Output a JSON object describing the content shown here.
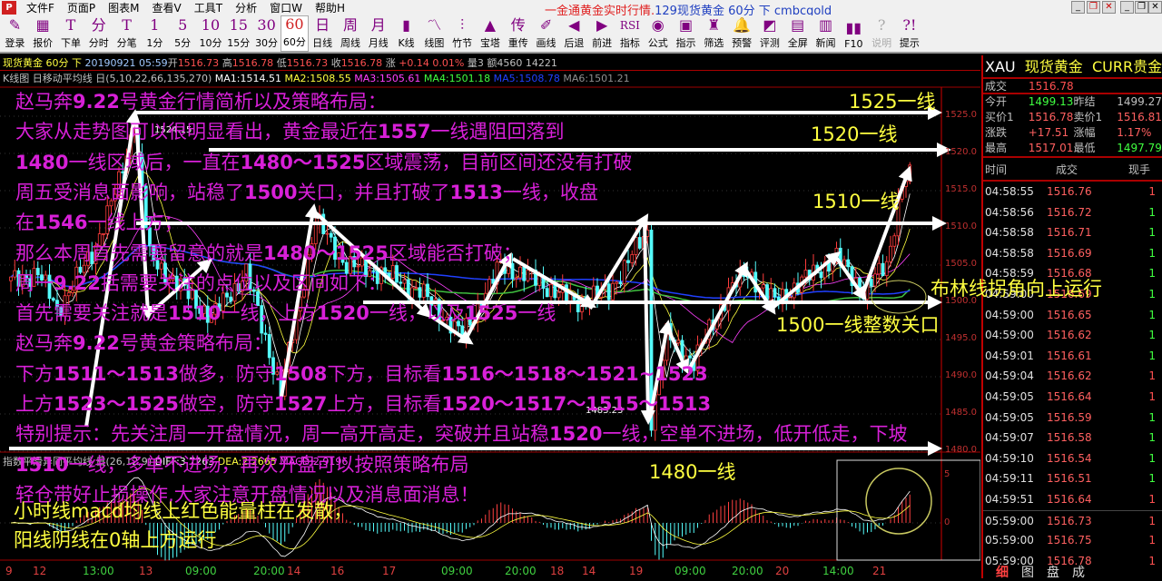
{
  "menubar": {
    "logo": "P",
    "items": [
      "文件F",
      "页面P",
      "图表M",
      "查看V",
      "工具T",
      "分析",
      "窗口W",
      "帮助H"
    ],
    "title_a": "一金通黄金实时行情.",
    "title_b": "129现货黄金 60分 下 cmbcgold"
  },
  "toolbar": [
    {
      "icon": "✎",
      "label": "登录"
    },
    {
      "icon": "▦",
      "label": "报价"
    },
    {
      "icon": "T",
      "label": "下单"
    },
    {
      "icon": "分",
      "label": "分时"
    },
    {
      "icon": "T",
      "label": "分笔"
    },
    {
      "icon": "1",
      "label": "1分"
    },
    {
      "icon": "5",
      "label": "5分"
    },
    {
      "icon": "10",
      "label": "10分"
    },
    {
      "icon": "15",
      "label": "15分"
    },
    {
      "icon": "30",
      "label": "30分"
    },
    {
      "icon": "60",
      "label": "60分",
      "selected": true
    },
    {
      "icon": "日",
      "label": "日线"
    },
    {
      "icon": "周",
      "label": "周线"
    },
    {
      "icon": "月",
      "label": "月线"
    },
    {
      "icon": "▮",
      "label": "K线"
    },
    {
      "icon": "〽",
      "label": "线图"
    },
    {
      "icon": "⫶",
      "label": "竹节"
    },
    {
      "icon": "▲",
      "label": "宝塔"
    },
    {
      "icon": "传",
      "label": "重传"
    },
    {
      "icon": "✐",
      "label": "画线"
    },
    {
      "icon": "◀",
      "label": "后退"
    },
    {
      "icon": "▶",
      "label": "前进"
    },
    {
      "icon": "RSI",
      "label": "指标"
    },
    {
      "icon": "◉",
      "label": "公式"
    },
    {
      "icon": "▣",
      "label": "指示"
    },
    {
      "icon": "♜",
      "label": "筛选"
    },
    {
      "icon": "🔔",
      "label": "预警"
    },
    {
      "icon": "◩",
      "label": "评测"
    },
    {
      "icon": "▤",
      "label": "全屏"
    },
    {
      "icon": "▥",
      "label": "新闻"
    },
    {
      "icon": "▮▮",
      "label": "F10"
    },
    {
      "icon": "?",
      "label": "说明",
      "disabled": true
    },
    {
      "icon": "?!",
      "label": "提示"
    }
  ],
  "info": {
    "name": "现货黄金 60分 下",
    "datetime": "20190921 05:59",
    "open_l": "开",
    "open": "1516.73",
    "high_l": "高",
    "high": "1516.78",
    "low_l": "低",
    "low": "1516.73",
    "close_l": "收",
    "close": "1516.78",
    "chg_l": "涨",
    "chg": "+0.14 0.01%",
    "vol": "量3",
    "amt": "额4560 14221"
  },
  "ma": {
    "title": "K线图 日移动平均线 日(5,10,22,66,135,270)",
    "ma1": "MA1:1514.51",
    "ma2": "MA2:1508.55",
    "ma3": "MA3:1505.61",
    "ma4": "MA4:1501.18",
    "ma5": "MA5:1508.78",
    "ma6": "MA6:1501.21"
  },
  "price_axis": [
    "1525.0",
    "1520.0",
    "1515.0",
    "1510.0",
    "1505.0",
    "1500.0",
    "1495.0",
    "1490.0",
    "1485.0",
    "1480.0"
  ],
  "macd": {
    "title": "指数平滑异同平均线 日(26,12,9)",
    "diff": "DIFF:3.7263",
    "dea": "DEA:2.2665",
    "macd": "MACD:2.9196",
    "axis": [
      "5",
      "0"
    ]
  },
  "time_axis": [
    {
      "t": "9",
      "d": true
    },
    {
      "t": "12",
      "d": true
    },
    {
      "t": "13:00"
    },
    {
      "t": "13",
      "d": true
    },
    {
      "t": "09:00"
    },
    {
      "t": "20:00"
    },
    {
      "t": "14",
      "d": true
    },
    {
      "t": "16",
      "d": true
    },
    {
      "t": "17",
      "d": true
    },
    {
      "t": "09:00"
    },
    {
      "t": "20:00"
    },
    {
      "t": "18",
      "d": true
    },
    {
      "t": "14",
      "d": true
    },
    {
      "t": "19",
      "d": true
    },
    {
      "t": "09:00"
    },
    {
      "t": "20:00"
    },
    {
      "t": "20",
      "d": true
    },
    {
      "t": "14:00"
    },
    {
      "t": "21",
      "d": true
    }
  ],
  "price_labels": {
    "high": "1524.15",
    "low": "1483.23"
  },
  "chart_data": {
    "type": "candlestick",
    "ylim": [
      1478,
      1528
    ],
    "waypoints_bar": [
      0,
      7,
      12,
      21,
      28,
      32,
      36,
      45,
      52,
      61,
      70,
      79,
      87,
      96,
      106,
      117,
      127,
      136,
      146,
      155,
      165,
      166,
      170,
      177,
      186,
      191,
      198,
      205,
      214,
      221,
      227,
      231,
      233
    ],
    "waypoints_price": [
      1502.8,
      1504,
      1499,
      1506.5,
      1516,
      1524.2,
      1506,
      1501.5,
      1498,
      1504,
      1488,
      1511,
      1505,
      1504,
      1501.5,
      1495.5,
      1505,
      1503,
      1500,
      1501.5,
      1509.5,
      1484.5,
      1495.5,
      1492,
      1501.5,
      1504,
      1500,
      1502.8,
      1506,
      1501.5,
      1505,
      1516,
      1516.8
    ]
  },
  "overlay_lines": [
    [
      "赵马奔",
      "9.22",
      "号黄金行情简析以及策略布局："
    ],
    [
      "大家从走势图可以很明显看出，黄金最近在",
      "1557",
      "一线遇阻回落到"
    ],
    [
      "1480",
      "一线区域后，一直在",
      "1480～1525",
      "区域震荡，目前区间还没有打破"
    ],
    [
      "周五受消息面影响，站稳了",
      "1500",
      "关口，并且打破了",
      "1513",
      "一线，收盘"
    ],
    [
      "在",
      "1546",
      "一线上方；"
    ],
    [
      "那么本周首先需要留意的就是",
      "1480～1525",
      "区域能否打破；"
    ],
    [
      "周一",
      "9.22",
      "括需要关注的点位以及区间如下："
    ],
    [
      "首先需要关注就是",
      "1510",
      "一线，上方",
      "1520",
      "一线，以及",
      "1525",
      "一线"
    ],
    [
      "赵马奔",
      "9.22",
      "号黄金策略布局："
    ],
    [
      "下方",
      "1511～1513",
      "做多，防守",
      "1508",
      "下方，目标看",
      "1516～1518～1521~1523"
    ],
    [
      "上方",
      "1523～1525",
      "做空，防守",
      "1527",
      "上方，目标看",
      "1520～1517～1515～1513"
    ],
    [
      "特别提示：先关注周一开盘情况，周一高开高走，突破并且站稳",
      "1520",
      "一线，空单不进场，低开低走，下坡"
    ],
    [
      "1510",
      "一线，多单不进场，再次开盘可以按照策略布局"
    ],
    [
      "轻仓带好止损操作,大家注意开盘情况以及消息面消息！"
    ]
  ],
  "annotations": {
    "a1525": "1525一线",
    "a1520": "1520一线",
    "a1510": "1510一线",
    "a1500": "1500一线整数关口",
    "boll": "布林线拐角向上运行",
    "a1480": "1480一线",
    "macd1": "小时线macd均线上红色能量柱在发散，",
    "macd2": "阳线阴线在0轴上方运行"
  },
  "right_panel": {
    "code": "XAU",
    "name": "现货黄金",
    "market": "CURR贵金",
    "last_l": "成交",
    "last": "1516.78",
    "quotes": [
      [
        "今开",
        "1499.13",
        "昨结",
        "1499.27"
      ],
      [
        "买价1",
        "1516.78",
        "卖价1",
        "1516.81"
      ],
      [
        "涨跌",
        "+17.51",
        "涨幅",
        "1.17%"
      ],
      [
        "最高",
        "1517.01",
        "最低",
        "1497.79"
      ]
    ],
    "tick_headers": [
      "时间",
      "成交",
      "现手"
    ],
    "ticks": [
      [
        "04:58:55",
        "1516.76",
        "1",
        "up"
      ],
      [
        "04:58:56",
        "1516.72",
        "1",
        "dn"
      ],
      [
        "04:58:58",
        "1516.71",
        "1",
        "dn"
      ],
      [
        "04:58:58",
        "1516.69",
        "1",
        "dn"
      ],
      [
        "04:58:59",
        "1516.68",
        "1",
        "dn"
      ],
      [
        "04:59:00",
        "1516.69",
        "1",
        "dn"
      ],
      [
        "04:59:00",
        "1516.65",
        "1",
        "dn"
      ],
      [
        "04:59:00",
        "1516.62",
        "1",
        "dn"
      ],
      [
        "04:59:01",
        "1516.61",
        "1",
        "dn"
      ],
      [
        "04:59:04",
        "1516.62",
        "1",
        "up"
      ],
      [
        "04:59:05",
        "1516.64",
        "1",
        "up"
      ],
      [
        "04:59:05",
        "1516.59",
        "1",
        "dn"
      ],
      [
        "04:59:07",
        "1516.58",
        "1",
        "dn"
      ],
      [
        "04:59:10",
        "1516.54",
        "1",
        "dn"
      ],
      [
        "04:59:11",
        "1516.51",
        "1",
        "dn"
      ],
      [
        "04:59:51",
        "1516.64",
        "1",
        "up"
      ],
      [
        "05:59:00",
        "1516.73",
        "1",
        "up"
      ],
      [
        "05:59:00",
        "1516.75",
        "1",
        "up"
      ],
      [
        "05:59:00",
        "1516.78",
        "1",
        "up"
      ]
    ],
    "tabs": [
      "细",
      "图",
      "盘",
      "成"
    ]
  },
  "colors": {
    "up": "#ff3c3c",
    "down": "#54fcfc",
    "overlay": "#d820d8",
    "annotation": "#ffff40"
  }
}
